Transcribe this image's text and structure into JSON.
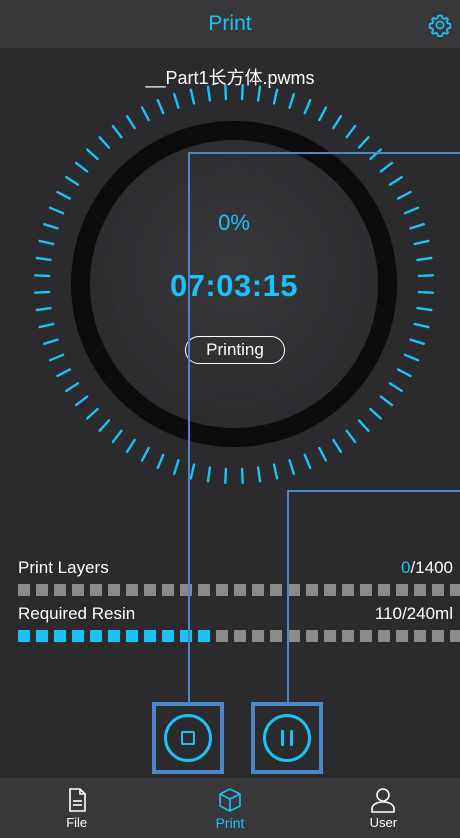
{
  "header": {
    "title": "Print",
    "settings_icon": "gear-icon"
  },
  "file": {
    "name": "__Part1长方体.pwms"
  },
  "progress": {
    "percent_text": "0%",
    "percent_value": 0,
    "time_remaining": "07:03:15",
    "status": "Printing"
  },
  "stats": {
    "layers": {
      "label": "Print Layers",
      "current": "0",
      "total": "/1400",
      "fraction": 0
    },
    "resin": {
      "label": "Required Resin",
      "value": "110/240ml",
      "fraction": 0.4583
    }
  },
  "controls": {
    "stop_icon": "stop-icon",
    "pause_icon": "pause-icon"
  },
  "tabs": [
    {
      "label": "File",
      "icon": "file-icon",
      "active": false
    },
    {
      "label": "Print",
      "icon": "cube-icon",
      "active": true
    },
    {
      "label": "User",
      "icon": "user-icon",
      "active": false
    }
  ],
  "colors": {
    "accent": "#1cc2f5",
    "background": "#2b2b2e",
    "bar_idle": "#8a8a8a",
    "highlight_frame": "#4a86c8"
  }
}
